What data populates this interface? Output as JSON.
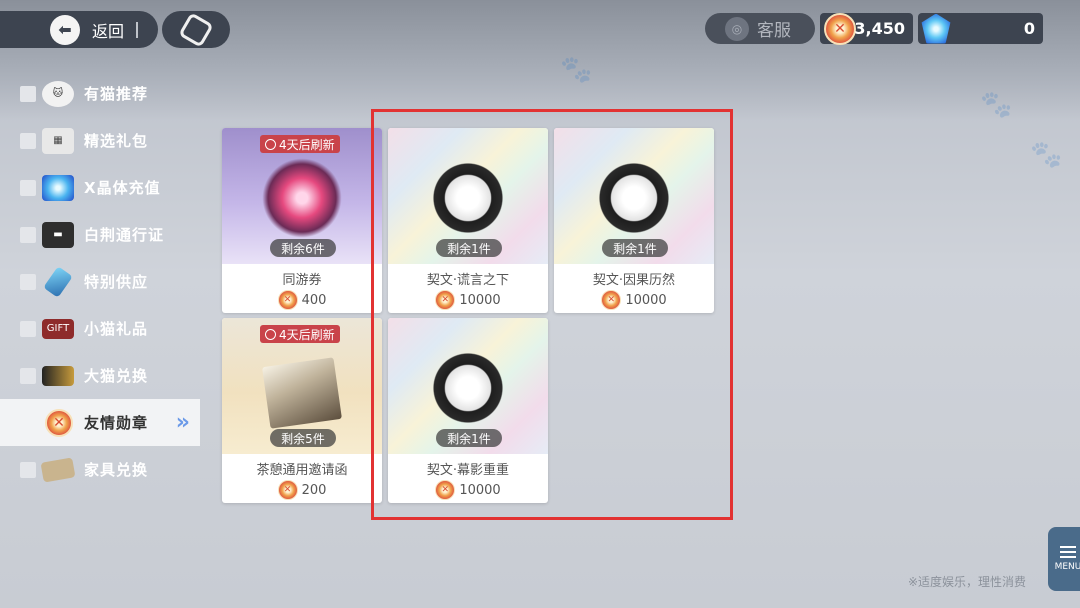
{
  "header": {
    "back_label": "返回",
    "service_label": "客服",
    "medal_balance": "3,450",
    "crystal_balance": "0"
  },
  "sidebar": {
    "items": [
      {
        "label": "有猫推荐",
        "icon": "cat-icon"
      },
      {
        "label": "精选礼包",
        "icon": "gift-box-icon"
      },
      {
        "label": "X晶体充值",
        "icon": "crystal-icon"
      },
      {
        "label": "白荆通行证",
        "icon": "pass-card-icon"
      },
      {
        "label": "特别供应",
        "icon": "potion-icon"
      },
      {
        "label": "小猫礼品",
        "icon": "ticket-icon"
      },
      {
        "label": "大猫兑换",
        "icon": "card-icon"
      },
      {
        "label": "友情勋章",
        "icon": "medal-icon",
        "active": true
      },
      {
        "label": "家具兑换",
        "icon": "furniture-icon"
      }
    ]
  },
  "shop": {
    "items": [
      {
        "name": "同游券",
        "price": "400",
        "stock": "剩余6件",
        "refresh": "4天后刷新"
      },
      {
        "name": "契文·谎言之下",
        "price": "10000",
        "stock": "剩余1件"
      },
      {
        "name": "契文·因果历然",
        "price": "10000",
        "stock": "剩余1件"
      },
      {
        "name": "茶憩通用邀请函",
        "price": "200",
        "stock": "剩余5件",
        "refresh": "4天后刷新"
      },
      {
        "name": "契文·幕影重重",
        "price": "10000",
        "stock": "剩余1件"
      }
    ]
  },
  "menu_label": "MENU",
  "footer_text": "※适度娱乐，理性消费",
  "colors": {
    "highlight": "#e23232",
    "active_chevron": "#6c9ae8",
    "refresh_badge": "#c9434a"
  }
}
